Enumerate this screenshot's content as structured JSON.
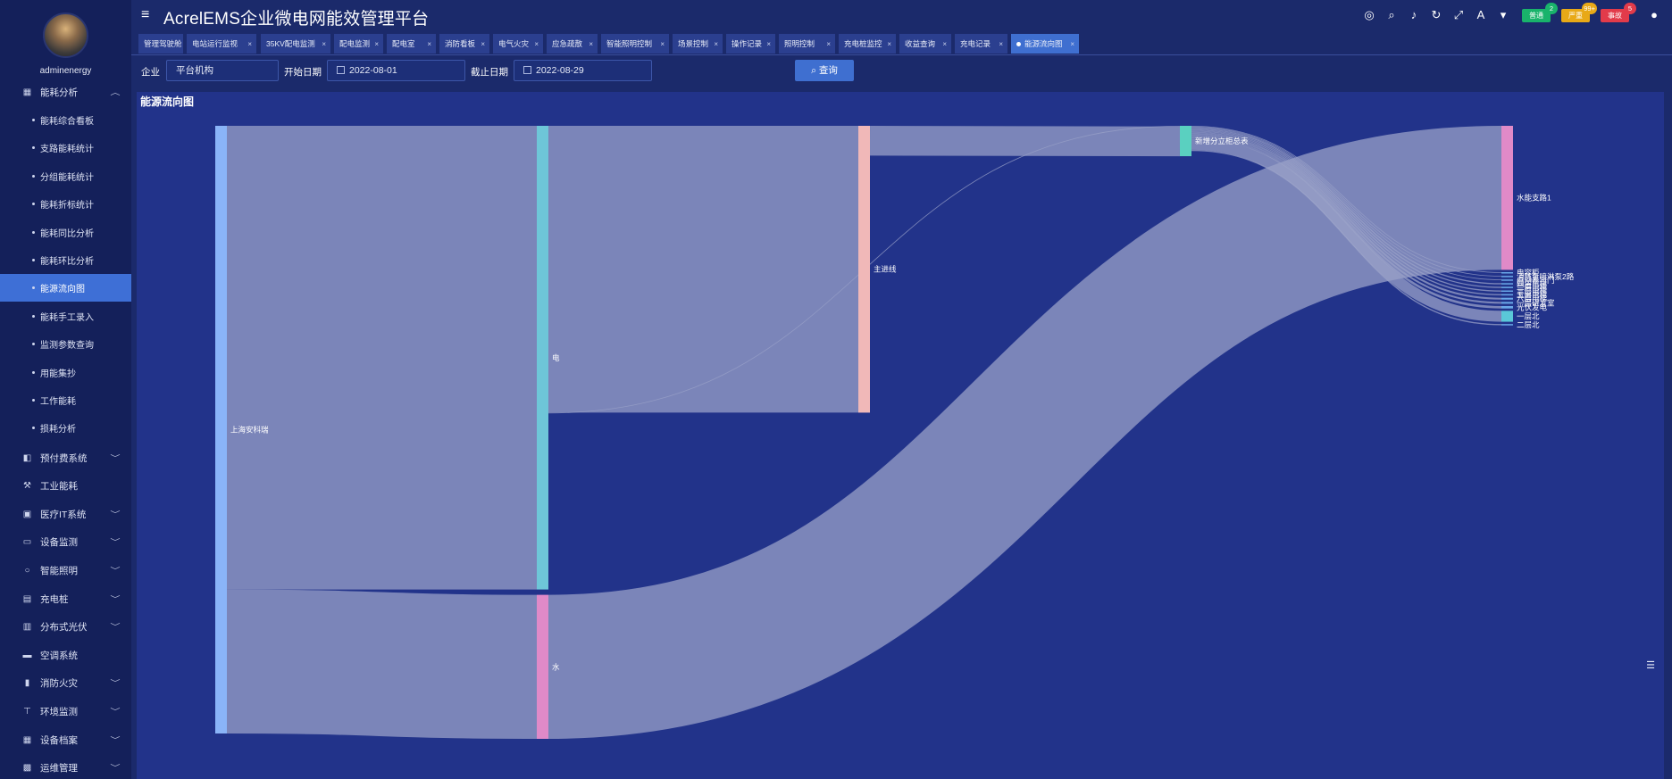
{
  "sidebar": {
    "username": "adminenergy",
    "group_label": "能耗分析",
    "items": [
      {
        "label": "能耗综合看板"
      },
      {
        "label": "支路能耗统计"
      },
      {
        "label": "分组能耗统计"
      },
      {
        "label": "能耗折标统计"
      },
      {
        "label": "能耗同比分析"
      },
      {
        "label": "能耗环比分析"
      },
      {
        "label": "能源流向图"
      },
      {
        "label": "能耗手工录入"
      },
      {
        "label": "监测参数查询"
      },
      {
        "label": "用能集抄"
      },
      {
        "label": "工作能耗"
      },
      {
        "label": "损耗分析"
      }
    ],
    "menus": [
      {
        "label": "预付费系统",
        "icon": "prepaid-icon"
      },
      {
        "label": "工业能耗",
        "icon": "industry-icon"
      },
      {
        "label": "医疗IT系统",
        "icon": "medical-icon"
      },
      {
        "label": "设备监测",
        "icon": "monitor-icon"
      },
      {
        "label": "智能照明",
        "icon": "bulb-icon"
      },
      {
        "label": "充电桩",
        "icon": "charger-icon"
      },
      {
        "label": "分布式光伏",
        "icon": "solar-icon"
      },
      {
        "label": "空调系统",
        "icon": "aircon-icon"
      },
      {
        "label": "消防火灾",
        "icon": "extinguisher-icon"
      },
      {
        "label": "环境监测",
        "icon": "environment-icon"
      },
      {
        "label": "设备档案",
        "icon": "archive-icon"
      },
      {
        "label": "运维管理",
        "icon": "maintenance-icon"
      }
    ]
  },
  "header": {
    "title": "AcrelEMS企业微电网能效管理平台",
    "alarms": [
      {
        "label": "普通",
        "count": "2",
        "color": "#19b36b",
        "badge_color": "#19b36b"
      },
      {
        "label": "严重",
        "count": "99+",
        "color": "#e8a917",
        "badge_color": "#e8a917"
      },
      {
        "label": "事故",
        "count": "5",
        "color": "#e23b4a",
        "badge_color": "#e23b4a"
      }
    ]
  },
  "tabs": [
    {
      "label": "管理驾驶舱"
    },
    {
      "label": "电站运行监视"
    },
    {
      "label": "35KV配电监测"
    },
    {
      "label": "配电监测"
    },
    {
      "label": "配电室"
    },
    {
      "label": "消防看板"
    },
    {
      "label": "电气火灾"
    },
    {
      "label": "应急疏散"
    },
    {
      "label": "智能照明控制"
    },
    {
      "label": "场景控制"
    },
    {
      "label": "操作记录"
    },
    {
      "label": "照明控制"
    },
    {
      "label": "充电桩监控"
    },
    {
      "label": "收益查询"
    },
    {
      "label": "充电记录"
    },
    {
      "label": "能源流向图"
    }
  ],
  "filters": {
    "company_label": "企业",
    "company_value": "平台机构",
    "start_label": "开始日期",
    "start_value": "2022-08-01",
    "end_label": "截止日期",
    "end_value": "2022-08-29",
    "query_label": "查询"
  },
  "panel": {
    "title": "能源流向图"
  },
  "chart_data": {
    "type": "sankey",
    "nodes": [
      {
        "name": "上海安科瑞",
        "color": "#8ab4f8"
      },
      {
        "name": "电",
        "color": "#6ec6d8"
      },
      {
        "name": "水",
        "color": "#e08ac8"
      },
      {
        "name": "主进线",
        "color": "#f0b8b8"
      },
      {
        "name": "新增分立柜总表",
        "color": "#5ad0c0"
      },
      {
        "name": "水能支路1",
        "color": "#e08ac8"
      },
      {
        "name": "电容柜",
        "color": "#6aa8e8"
      },
      {
        "name": "消防泵喷淋泵2路",
        "color": "#6aa8e8"
      },
      {
        "name": "自动卷帘门",
        "color": "#6aa8e8"
      },
      {
        "name": "四层电梯",
        "color": "#6aa8e8"
      },
      {
        "name": "二层电梯",
        "color": "#6aa8e8"
      },
      {
        "name": "三层电梯",
        "color": "#6aa8e8"
      },
      {
        "name": "五层电梯",
        "color": "#6aa8e8"
      },
      {
        "name": "六层电梯",
        "color": "#6aa8e8"
      },
      {
        "name": "一层研发室",
        "color": "#6aa8e8"
      },
      {
        "name": "光伏发电",
        "color": "#6aa8e8"
      },
      {
        "name": "一层北",
        "color": "#5ac8d8"
      },
      {
        "name": "二层北",
        "color": "#6aa8e8"
      }
    ],
    "links": [
      {
        "source": "上海安科瑞",
        "target": "电",
        "value": 76.3
      },
      {
        "source": "上海安科瑞",
        "target": "水",
        "value": 23.7
      },
      {
        "source": "电",
        "target": "主进线",
        "value": 47.2
      },
      {
        "source": "电",
        "target": "新增分立柜总表",
        "value": 0.1
      },
      {
        "source": "水",
        "target": "水能支路1",
        "value": 23.7
      },
      {
        "source": "主进线",
        "target": "新增分立柜总表",
        "value": 4.9
      },
      {
        "source": "新增分立柜总表",
        "target": "电容柜",
        "value": 0.1
      },
      {
        "source": "新增分立柜总表",
        "target": "消防泵喷淋泵2路",
        "value": 0.1
      },
      {
        "source": "新增分立柜总表",
        "target": "自动卷帘门",
        "value": 0.1
      },
      {
        "source": "新增分立柜总表",
        "target": "四层电梯",
        "value": 0.2
      },
      {
        "source": "新增分立柜总表",
        "target": "二层电梯",
        "value": 0.2
      },
      {
        "source": "新增分立柜总表",
        "target": "三层电梯",
        "value": 0.2
      },
      {
        "source": "新增分立柜总表",
        "target": "五层电梯",
        "value": 0.2
      },
      {
        "source": "新增分立柜总表",
        "target": "六层电梯",
        "value": 0.3
      },
      {
        "source": "新增分立柜总表",
        "target": "一层研发室",
        "value": 0.3
      },
      {
        "source": "新增分立柜总表",
        "target": "光伏发电",
        "value": 0.4
      },
      {
        "source": "新增分立柜总表",
        "target": "一层北",
        "value": 1.8
      },
      {
        "source": "新增分立柜总表",
        "target": "二层北",
        "value": 0.2
      }
    ]
  }
}
